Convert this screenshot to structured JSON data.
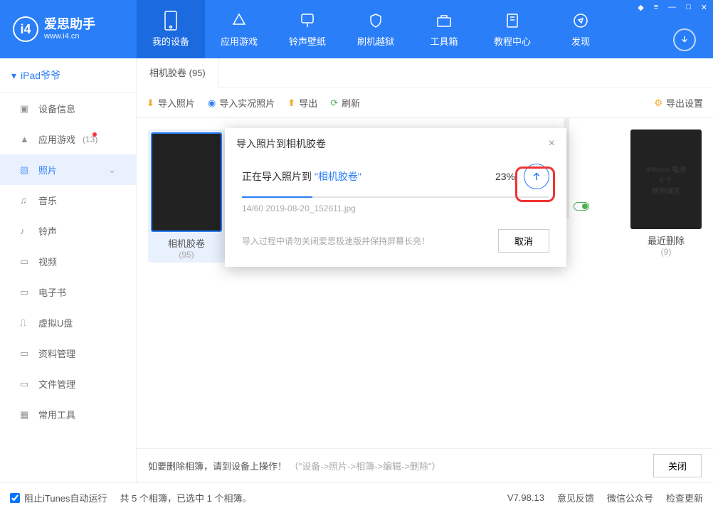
{
  "logo": {
    "cn": "爱思助手",
    "en": "www.i4.cn",
    "mark": "i4"
  },
  "nav": [
    {
      "label": "我的设备"
    },
    {
      "label": "应用游戏"
    },
    {
      "label": "铃声壁纸"
    },
    {
      "label": "刷机越狱"
    },
    {
      "label": "工具箱"
    },
    {
      "label": "教程中心"
    },
    {
      "label": "发现"
    }
  ],
  "device": {
    "name": "iPad爷爷"
  },
  "sidebar": [
    {
      "label": "设备信息"
    },
    {
      "label": "应用游戏",
      "badge": "(13)",
      "dot": true
    },
    {
      "label": "照片"
    },
    {
      "label": "音乐"
    },
    {
      "label": "铃声"
    },
    {
      "label": "视频"
    },
    {
      "label": "电子书"
    },
    {
      "label": "虚拟U盘"
    },
    {
      "label": "资料管理"
    },
    {
      "label": "文件管理"
    },
    {
      "label": "常用工具"
    }
  ],
  "subtab": "相机胶卷 (95)",
  "toolbar": {
    "import": "导入照片",
    "importLive": "导入实况照片",
    "export": "导出",
    "refresh": "刷新",
    "settings": "导出设置"
  },
  "albums": [
    {
      "name": "相机胶卷",
      "count": "(95)"
    },
    {
      "name": "最近删除",
      "count": "(9)",
      "overlay1": "iPhone  电池",
      "overlay2": "5 个",
      "overlay3": "使用误区"
    }
  ],
  "modal": {
    "title": "导入照片到相机胶卷",
    "progressPrefix": "正在导入照片到",
    "dest": "\"相机胶卷\"",
    "percent": "23%",
    "file": "14/60 2019-08-20_152611.jpg",
    "warn": "导入过程中请勿关闭爱思极速版并保持屏幕长亮！",
    "cancel": "取消"
  },
  "hint": {
    "main": "如要删除相簿，请到设备上操作！",
    "sub": "（\"设备->照片->相簿->编辑->删除\"）",
    "close": "关闭"
  },
  "footer": {
    "block": "阻止iTunes自动运行",
    "count": "共 5 个相簿，已选中 1 个相簿。",
    "ver": "V7.98.13",
    "fb": "意见反馈",
    "wx": "微信公众号",
    "upd": "检查更新"
  }
}
